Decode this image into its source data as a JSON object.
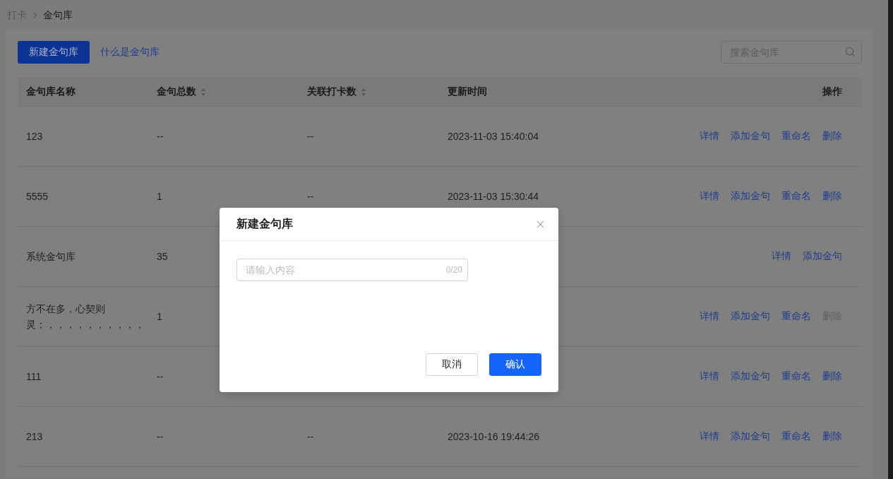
{
  "breadcrumb": [
    {
      "label": "打卡",
      "current": false
    },
    {
      "label": "金句库",
      "current": true
    }
  ],
  "toolbar": {
    "primary_button": "新建金句库",
    "help_link": "什么是金句库",
    "search": {
      "placeholder": "搜索金句库"
    }
  },
  "table": {
    "columns": [
      {
        "label": "金句库名称",
        "sortable": false
      },
      {
        "label": "金句总数",
        "sortable": true
      },
      {
        "label": "关联打卡数",
        "sortable": true
      },
      {
        "label": "更新时间",
        "sortable": false
      },
      {
        "label": "操作",
        "sortable": false
      }
    ],
    "rows": [
      {
        "name": "123",
        "total": "--",
        "linked": "--",
        "updated": "2023-11-03 15:40:04",
        "actions": [
          {
            "label": "详情",
            "disabled": false
          },
          {
            "label": "添加金句",
            "disabled": false
          },
          {
            "label": "重命名",
            "disabled": false
          },
          {
            "label": "删除",
            "disabled": false
          }
        ]
      },
      {
        "name": "5555",
        "total": "1",
        "linked": "--",
        "updated": "2023-11-03 15:30:44",
        "actions": [
          {
            "label": "详情",
            "disabled": false
          },
          {
            "label": "添加金句",
            "disabled": false
          },
          {
            "label": "重命名",
            "disabled": false
          },
          {
            "label": "删除",
            "disabled": false
          }
        ]
      },
      {
        "name": "系统金句库",
        "total": "35",
        "actions": [
          {
            "label": "详情",
            "disabled": false
          },
          {
            "label": "添加金句",
            "disabled": false
          }
        ]
      },
      {
        "name": "方不在多，心契则灵；，，，，，，，，，，",
        "total": "1",
        "actions": [
          {
            "label": "详情",
            "disabled": false
          },
          {
            "label": "添加金句",
            "disabled": false
          },
          {
            "label": "重命名",
            "disabled": false
          },
          {
            "label": "删除",
            "disabled": true
          }
        ]
      },
      {
        "name": "111",
        "total": "--",
        "actions": [
          {
            "label": "详情",
            "disabled": false
          },
          {
            "label": "添加金句",
            "disabled": false
          },
          {
            "label": "重命名",
            "disabled": false
          },
          {
            "label": "删除",
            "disabled": false
          }
        ]
      },
      {
        "name": "213",
        "total": "--",
        "linked": "--",
        "updated": "2023-10-16 19:44:26",
        "actions": [
          {
            "label": "详情",
            "disabled": false
          },
          {
            "label": "添加金句",
            "disabled": false
          },
          {
            "label": "重命名",
            "disabled": false
          },
          {
            "label": "删除",
            "disabled": false
          }
        ]
      }
    ]
  },
  "dialog": {
    "title": "新建金句库",
    "input": {
      "placeholder": "请输入内容",
      "counter": "0/20"
    },
    "buttons": [
      {
        "label": "取消",
        "kind": "default"
      },
      {
        "label": "确认",
        "kind": "primary"
      }
    ]
  }
}
